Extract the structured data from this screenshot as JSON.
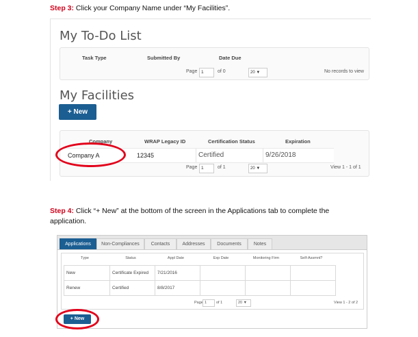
{
  "step3": {
    "label": "Step 3:",
    "text": " Click your Company Name under “My Facilities”."
  },
  "todo": {
    "title": "My To-Do List",
    "headers": [
      "Task Type",
      "Submitted By",
      "Date Due"
    ],
    "pager": {
      "page_word": "Page",
      "page_value": "1",
      "of_text": "of 0",
      "per_page": "20 ▼",
      "status": "No records to view"
    }
  },
  "facilities": {
    "title": "My Facilities",
    "new_button": "+ New",
    "headers": [
      "Company",
      "WRAP Legacy ID",
      "Certification Status",
      "Expiration"
    ],
    "row": {
      "company": "Company A",
      "legacy_id": "12345",
      "status": "Certified",
      "expiration": "9/26/2018"
    },
    "pager": {
      "page_word": "Page",
      "page_value": "1",
      "of_text": "of 1",
      "per_page": "20 ▼",
      "status": "View 1 - 1 of 1"
    }
  },
  "step4": {
    "label": "Step 4:",
    "line1": " Click “+ New” at the bottom of the screen in the Applications tab to complete the",
    "line2": "application."
  },
  "app_panel": {
    "tabs": [
      "Applications",
      "Non-Compliances",
      "Contacts",
      "Addresses",
      "Documents",
      "Notes"
    ],
    "headers": [
      "Type",
      "Status",
      "Appl Date",
      "Exp Date",
      "Monitoring Firm",
      "Self-Assmnt?"
    ],
    "rows": [
      {
        "type": "New",
        "status": "Certificate Expired",
        "appl_date": "7/21/2016"
      },
      {
        "type": "Renew",
        "status": "Certified",
        "appl_date": "8/8/2017"
      }
    ],
    "pager": {
      "page_word": "Page",
      "page_value": "1",
      "of_text": "of 1",
      "per_page": "20 ▼",
      "status": "View 1 - 2 of 2"
    },
    "new_button": "+ New"
  },
  "colors": {
    "step_label": "#d0021b",
    "button": "#1b5e92",
    "highlight_oval": "#e2001a"
  }
}
